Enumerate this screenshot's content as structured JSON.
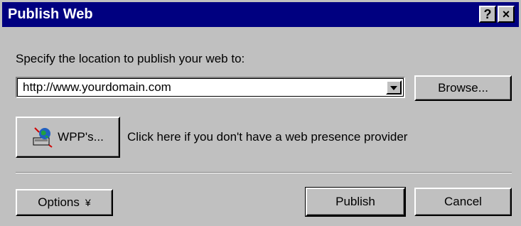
{
  "window": {
    "title": "Publish Web",
    "help_label": "?",
    "close_label": "×"
  },
  "location": {
    "label": "Specify the location to publish your web to:",
    "url_value": "http://www.yourdomain.com",
    "browse_label": "Browse..."
  },
  "wpp": {
    "button_label": "WPP's...",
    "description": "Click here if you don't have a web presence provider"
  },
  "footer": {
    "options_label": "Options",
    "options_arrow": "¥",
    "publish_label": "Publish",
    "cancel_label": "Cancel"
  },
  "icons": {
    "wpp_icon": "globe-computer-icon",
    "combo_arrow": "chevron-down-icon",
    "help": "help-icon",
    "close": "close-icon"
  },
  "colors": {
    "titlebar": "#000080",
    "face": "#c0c0c0"
  }
}
